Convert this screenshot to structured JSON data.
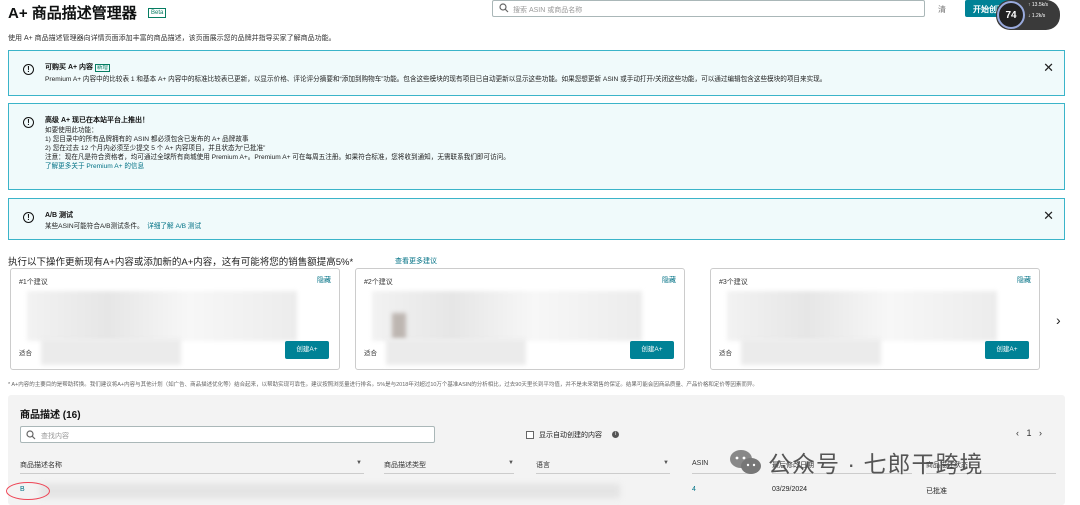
{
  "header": {
    "title": "A+ 商品描述管理器",
    "badge": "Beta",
    "search_placeholder": "搜索 ASIN 或商品名称",
    "clear": "清",
    "start_button": "开始创建",
    "gauge_value": "74",
    "gauge_line1": "↑ 13.5k/s",
    "gauge_line2": "↓ 1.2k/s"
  },
  "subtitle": "使用 A+ 商品描述管理器向详情页面添加丰富的商品描述，该页面展示您的品牌并指导买家了解商品功能。",
  "alerts": [
    {
      "title": "可购买 A+ 内容",
      "tag": "新增",
      "body": "Premium A+ 内容中的比较表 1 和基本 A+ 内容中的标准比较表已更新，以显示价格、评论评分摘要和“添加到购物车”功能。包含这些模块的现有项目已自动更新以显示这些功能。如果您想更新 ASIN 或手动打开/关闭这些功能，可以通过编辑包含这些模块的项目来实现。"
    },
    {
      "title": "高级 A+ 现已在本站平台上推出！",
      "line1": "如要使用此功能：",
      "line2": "1) 您目录中的所有品牌拥有的 ASIN 都必须包含已发布的 A+ 品牌故事",
      "line2_link": "A+ 品牌故事",
      "line3": "2) 您在过去 12 个月内必须至少提交 5 个 A+ 内容项目，并且状态为“已批准”",
      "line4": "注意：现在凡是符合资格者，均可通过全球所有商城使用 Premium A+。Premium A+ 可在每周五注册。如果符合标准，您将收到通知，无需联系我们即可访问。",
      "link": "了解更多关于 Premium A+ 的信息"
    },
    {
      "title": "A/B 测试",
      "body": "某些ASIN可能符合A/B测试条件。",
      "link": "详细了解 A/B 测试"
    }
  ],
  "suggestions": {
    "headline": "执行以下操作更新现有A+内容或添加新的A+内容，这有可能将您的销售额提高5%*",
    "more_link": "查看更多建议",
    "cards": [
      {
        "num": "#1个建议",
        "hide": "隐藏",
        "prefix": "适合",
        "button": "创建A+"
      },
      {
        "num": "#2个建议",
        "hide": "隐藏",
        "prefix": "适合",
        "button": "创建A+"
      },
      {
        "num": "#3个建议",
        "hide": "隐藏",
        "prefix": "适合",
        "button": "创建A+"
      }
    ],
    "next": "›"
  },
  "footnote": "* A+内容的主要目的是帮助转换。我们建议将A+内容与其他计划（如广告、商品描述优化等）结合起来，以帮助实现可靠性。建议按照浏览量进行排名。5%是与2018年对超过10万个基准ASIN的分析相比，过去90天里长到平均值，并不是未来销售的保证。结果可能会因商品质量、产品价格和定价等因素而异。",
  "table": {
    "title": "商品描述 (16)",
    "filter_placeholder": "查找内容",
    "auto_label": "显示自动创建的内容",
    "pager_prev": "‹",
    "pager_page": "1",
    "pager_next": "›",
    "headers": [
      "商品描述名称",
      "商品描述类型",
      "语言",
      "ASIN",
      "最后修改日期",
      "商品描述状态"
    ],
    "row": {
      "name_prefix": "B",
      "asin": "4",
      "date": "03/29/2024",
      "status": "已批准"
    }
  },
  "watermark": "公众号 · 七郎干跨境"
}
